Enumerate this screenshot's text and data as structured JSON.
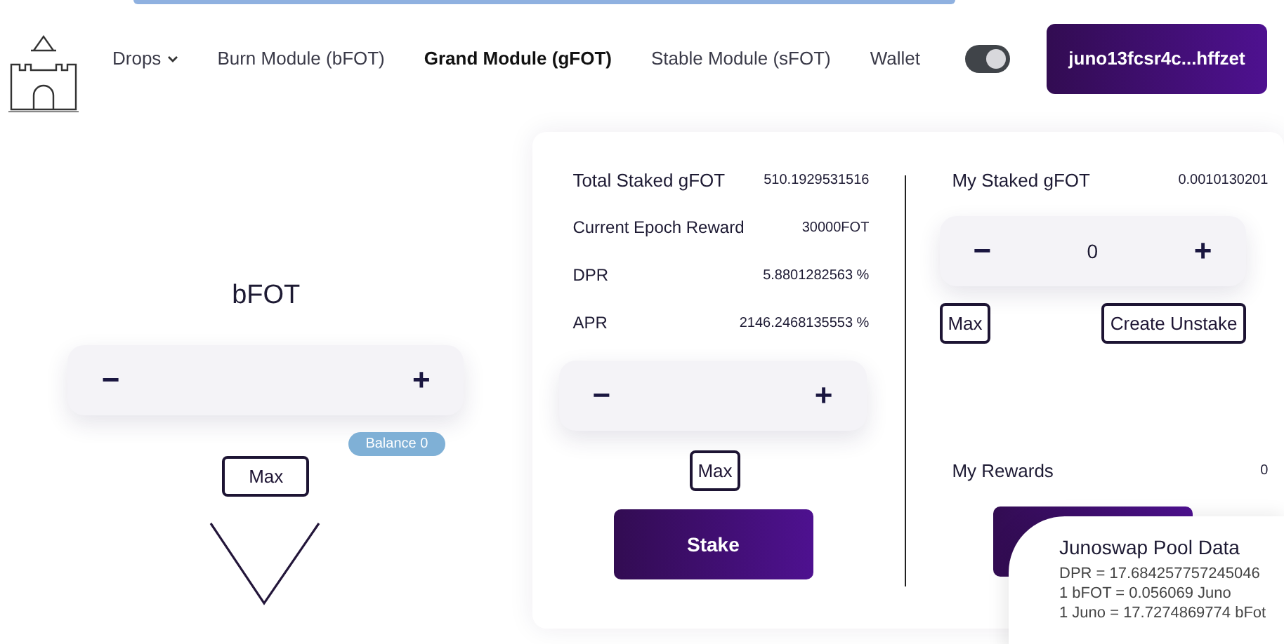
{
  "nav": {
    "items": [
      {
        "label": "Drops",
        "kind": "dropdown",
        "selected": false
      },
      {
        "label": "Burn Module (bFOT)",
        "kind": "link",
        "selected": false
      },
      {
        "label": "Grand Module (gFOT)",
        "kind": "link",
        "selected": true
      },
      {
        "label": "Stable Module (sFOT)",
        "kind": "link",
        "selected": false
      },
      {
        "label": "Wallet",
        "kind": "link",
        "selected": false
      }
    ],
    "theme_toggle": {
      "on": true
    },
    "wallet_button": "juno13fcsr4c...hffzet"
  },
  "burn": {
    "title": "bFOT",
    "minus": "−",
    "plus": "+",
    "balance": "Balance 0",
    "max": "Max"
  },
  "stake": {
    "stats": [
      {
        "label": "Total Staked gFOT",
        "value": "510.1929531516"
      },
      {
        "label": "Current Epoch Reward",
        "value": "30000FOT"
      },
      {
        "label": "DPR",
        "value": "5.8801282563 %"
      },
      {
        "label": "APR",
        "value": "2146.2468135553 %"
      }
    ],
    "minus": "−",
    "plus": "+",
    "max": "Max",
    "button": "Stake"
  },
  "unstake": {
    "label": "My Staked gFOT",
    "value": "0.0010130201",
    "minus": "−",
    "amount": "0",
    "plus": "+",
    "max": "Max",
    "button": "Create Unstake",
    "rewards_label": "My Rewards",
    "rewards_value": "0"
  },
  "pool_popup": {
    "title": "Junoswap Pool Data",
    "lines": [
      "DPR = 17.684257757245046",
      "1 bFOT = 0.056069 Juno",
      "1 Juno = 17.7274869774 bFot"
    ]
  }
}
